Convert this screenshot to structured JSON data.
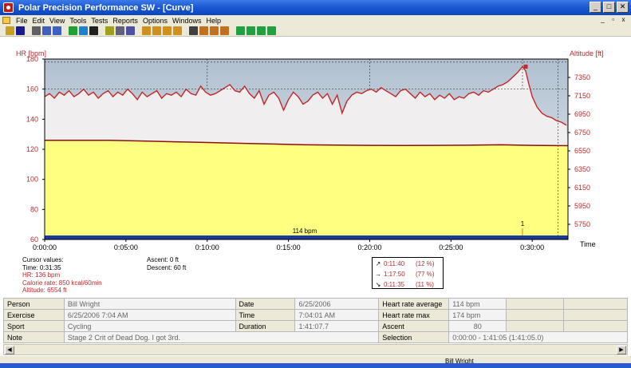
{
  "window": {
    "title": "Polar Precision Performance SW - [Curve]",
    "controls": [
      "_",
      "□",
      "✕"
    ]
  },
  "menu": {
    "items": [
      "File",
      "Edit",
      "View",
      "Tools",
      "Tests",
      "Reports",
      "Options",
      "Windows",
      "Help"
    ],
    "mdi_controls": [
      "_",
      "▫",
      "x"
    ]
  },
  "toolbar": {
    "icons": [
      "open-icon",
      "save-icon",
      "print-icon",
      "copy-icon",
      "copy2-icon",
      "refresh-icon",
      "globe-icon",
      "ball-icon",
      "tool-icon",
      "window-icon",
      "grid-icon",
      "chart-curve-icon",
      "chart-bars-icon",
      "chart-scale-icon",
      "chart-table-icon",
      "zoom-icon",
      "chart-area-icon",
      "chart-area2-icon",
      "chart-area3-icon",
      "bar-chart1-icon",
      "bar-chart2-icon",
      "bar-chart3-icon",
      "bar-chart4-icon"
    ],
    "colors": [
      "#c8a028",
      "#1a1a8a",
      "#606060",
      "#4060c0",
      "#4060c0",
      "#20a030",
      "#2080d0",
      "#202020",
      "#a0a020",
      "#606080",
      "#5050a0",
      "#d09020",
      "#d09020",
      "#d09020",
      "#d09020",
      "#404040",
      "#c07020",
      "#c07020",
      "#c07020",
      "#20a040",
      "#20a040",
      "#20a040",
      "#20a040"
    ]
  },
  "chart_data": {
    "type": "line",
    "y_left_label": "HR [bpm]",
    "y_right_label": "Altitude [ft]",
    "x_label": "Time",
    "x_ticks": [
      "0:00:00",
      "0:05:00",
      "0:10:00",
      "0:15:00",
      "0:20:00",
      "0:25:00",
      "0:30:00"
    ],
    "y_left_ticks": [
      "60",
      "80",
      "100",
      "120",
      "140",
      "160",
      "180"
    ],
    "y_left_range": [
      60,
      180
    ],
    "y_right_ticks": [
      "5750",
      "5950",
      "6150",
      "6350",
      "6550",
      "6750",
      "6950",
      "7150",
      "7350"
    ],
    "avg_label": "114 bpm",
    "marker_label": "1",
    "marker_time_min": 29.4,
    "cursor_time_min": 31.58,
    "x_range_min": [
      0,
      32.2
    ],
    "hr_color": "#c0282a",
    "altitude_fill": "#ffff80",
    "hr_series": {
      "name": "HR",
      "t": [
        0,
        0.3,
        0.6,
        0.9,
        1.2,
        1.5,
        1.8,
        2.1,
        2.4,
        2.7,
        3,
        3.3,
        3.6,
        3.9,
        4.2,
        4.5,
        4.8,
        5.1,
        5.4,
        5.7,
        6,
        6.3,
        6.6,
        6.9,
        7.2,
        7.5,
        7.8,
        8.1,
        8.4,
        8.7,
        9,
        9.3,
        9.6,
        9.9,
        10.2,
        10.5,
        10.8,
        11.1,
        11.4,
        11.7,
        12,
        12.3,
        12.6,
        12.9,
        13.2,
        13.5,
        13.8,
        14.1,
        14.4,
        14.7,
        15,
        15.3,
        15.6,
        15.9,
        16.2,
        16.5,
        16.8,
        17.1,
        17.4,
        17.7,
        18,
        18.3,
        18.6,
        18.9,
        19.2,
        19.5,
        19.8,
        20.1,
        20.4,
        20.7,
        21,
        21.3,
        21.6,
        21.9,
        22.2,
        22.5,
        22.8,
        23.1,
        23.4,
        23.7,
        24,
        24.3,
        24.6,
        24.9,
        25.2,
        25.5,
        25.8,
        26.1,
        26.4,
        26.7,
        27,
        27.3,
        27.6,
        27.9,
        28.2,
        28.5,
        28.8,
        29.1,
        29.4,
        29.6,
        29.8,
        30,
        30.3,
        30.6,
        30.9,
        31.2,
        31.5,
        31.8,
        32.1
      ],
      "hr": [
        155,
        157,
        154,
        158,
        156,
        159,
        155,
        157,
        160,
        156,
        158,
        154,
        157,
        159,
        155,
        158,
        156,
        160,
        157,
        153,
        158,
        155,
        157,
        159,
        154,
        157,
        156,
        158,
        155,
        160,
        157,
        156,
        162,
        158,
        156,
        157,
        159,
        161,
        163,
        159,
        158,
        162,
        157,
        154,
        159,
        150,
        156,
        158,
        154,
        146,
        153,
        158,
        155,
        150,
        152,
        156,
        158,
        154,
        157,
        150,
        156,
        144,
        152,
        156,
        158,
        157,
        159,
        160,
        158,
        161,
        159,
        157,
        155,
        159,
        160,
        157,
        154,
        158,
        155,
        157,
        153,
        156,
        154,
        157,
        153,
        155,
        154,
        157,
        158,
        156,
        159,
        158,
        160,
        162,
        163,
        165,
        168,
        171,
        175,
        172,
        163,
        155,
        148,
        144,
        142,
        141,
        139,
        138,
        136
      ]
    },
    "altitude_series": {
      "name": "Altitude",
      "t": [
        0,
        2,
        4,
        6,
        8,
        10,
        12,
        14,
        16,
        18,
        20,
        22,
        24,
        26,
        28,
        30,
        32.2
      ],
      "hr_equiv": [
        126,
        126,
        126,
        125.5,
        125,
        124.5,
        124,
        123.5,
        123,
        122.8,
        122.6,
        122.5,
        122.6,
        122.7,
        123,
        122.6,
        122.4
      ]
    }
  },
  "cursor_values": {
    "header": "Cursor values:",
    "time": "Time: 0:31:35",
    "hr": "HR: 136 bpm",
    "calorie": "Calorie rate: 850 kcal/60min",
    "altitude": "Altitude: 6554 ft"
  },
  "ascent": {
    "ascent": "Ascent: 0 ft",
    "descent": "Descent: 60 ft"
  },
  "zones": [
    {
      "arrow": "↗",
      "time": "0:11:40",
      "pct": "(12 %)"
    },
    {
      "arrow": "→",
      "time": "1:17:50",
      "pct": "(77 %)"
    },
    {
      "arrow": "↘",
      "time": "0:11:35",
      "pct": "(11 %)"
    }
  ],
  "summary_table": {
    "rows": [
      {
        "l1": "Person",
        "v1": "Bill Wright",
        "l2": "Date",
        "v2": "6/25/2006",
        "l3": "Heart rate average",
        "v3": "114 bpm"
      },
      {
        "l1": "Exercise",
        "v1": "6/25/2006 7:04 AM",
        "l2": "Time",
        "v2": "7:04:01 AM",
        "l3": "Heart rate max",
        "v3": "174 bpm"
      },
      {
        "l1": "Sport",
        "v1": "Cycling",
        "l2": "Duration",
        "v2": "1:41:07.7",
        "l3": "Ascent",
        "v3": "80"
      },
      {
        "l1": "Note",
        "v1": "Stage 2 Crit of Dead Dog. I got 3rd.",
        "l2": "",
        "v2": "",
        "l3": "Selection",
        "v3": "0:00:00 - 1:41:05 (1:41:05.0)"
      }
    ]
  },
  "statusbar": {
    "user": "Bill Wright"
  }
}
